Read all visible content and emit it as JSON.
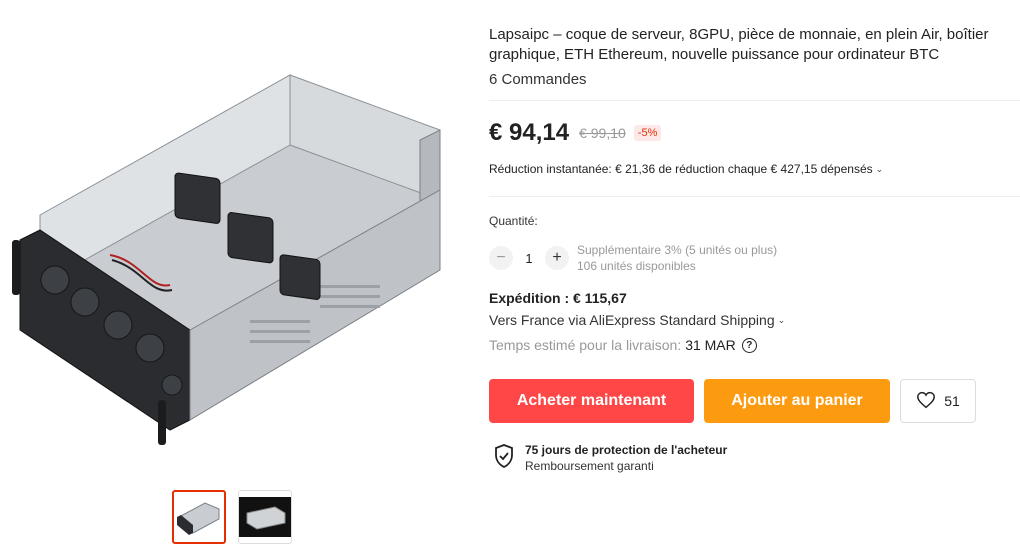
{
  "product": {
    "title": "Lapsaipc – coque de serveur, 8GPU, pièce de monnaie, en plein Air, boîtier graphique, ETH Ethereum, nouvelle puissance pour ordinateur BTC",
    "orders": "6 Commandes"
  },
  "price": {
    "current": "€ 94,14",
    "original": "€ 99,10",
    "discount": "-5%"
  },
  "promo": {
    "text": "Réduction instantanée: € 21,36 de réduction chaque € 427,15 dépensés"
  },
  "quantity": {
    "label": "Quantité:",
    "minus": "−",
    "value": "1",
    "plus": "+",
    "extra": "Supplémentaire 3% (5 unités ou plus)",
    "available": "106 unités disponibles"
  },
  "shipping": {
    "title": "Expédition : € 115,67",
    "route": "Vers France via AliExpress Standard Shipping",
    "estimate_label": "Temps estimé pour la livraison:",
    "estimate_date": "31 MAR",
    "help": "?"
  },
  "actions": {
    "buy_now": "Acheter maintenant",
    "add_to_cart": "Ajouter au panier",
    "wishlist_count": "51"
  },
  "protection": {
    "title": "75 jours de protection de l'acheteur",
    "subtitle": "Remboursement garanti"
  },
  "colors": {
    "buy": "#ff4747",
    "cart": "#fd9b10",
    "discount": "#e62e04"
  },
  "icons": {
    "wishlist": "heart-icon",
    "protection": "shield-check-icon",
    "dropdown": "chevron-down-icon",
    "help": "question-circle-icon"
  }
}
